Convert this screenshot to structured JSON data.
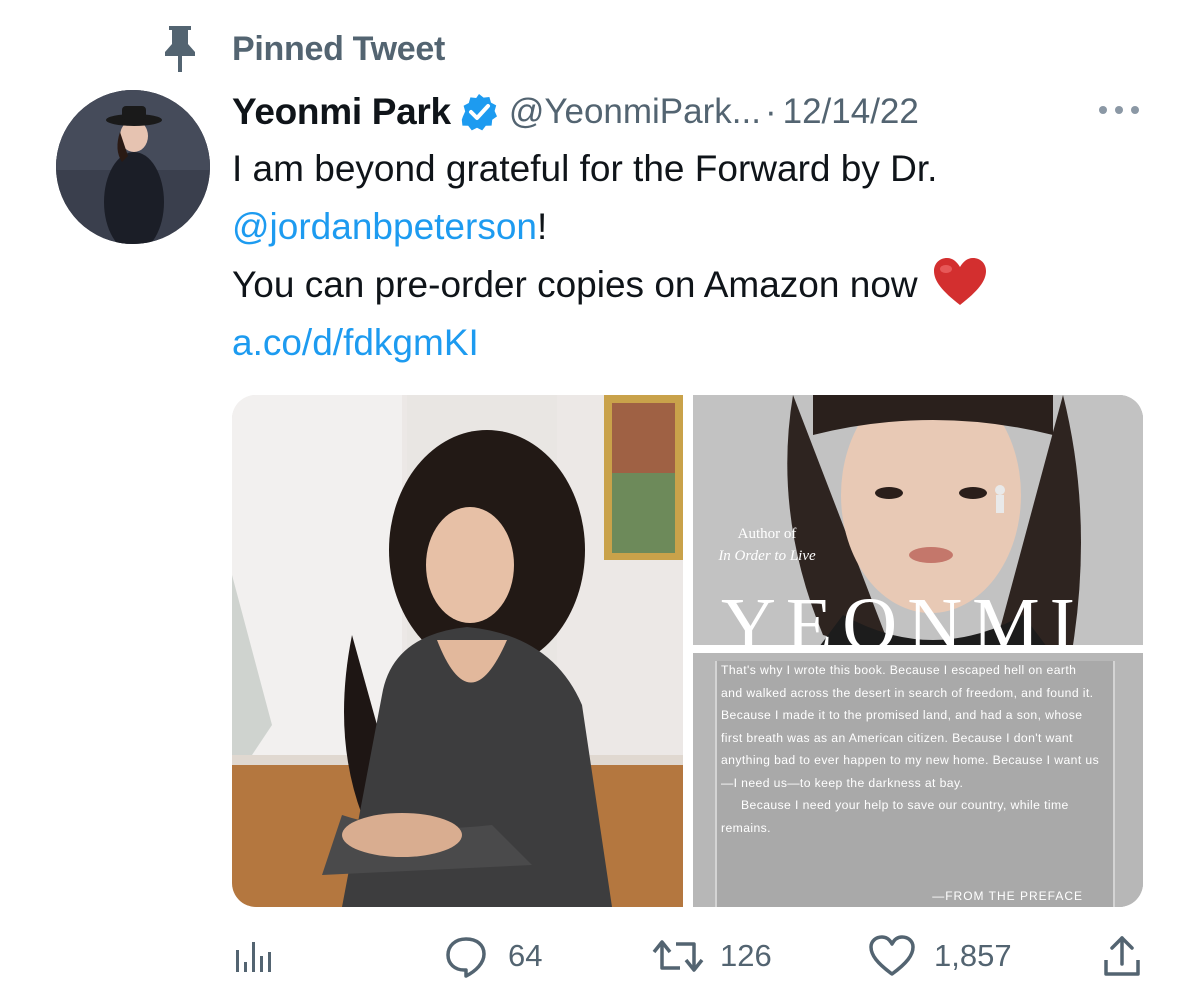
{
  "pinned": {
    "label": "Pinned Tweet",
    "icon": "pin-icon"
  },
  "author": {
    "name": "Yeonmi Park",
    "handle": "@YeonmiPark...",
    "separator": "·",
    "date": "12/14/22",
    "verified": true
  },
  "tweet": {
    "line1": "I am beyond grateful for the Forward by Dr.",
    "mention": "@jordanbpeterson",
    "mention_suffix": "!",
    "line3": "You can pre-order copies on Amazon now",
    "link": "a.co/d/fdkgmKI"
  },
  "book_cover": {
    "author_line1": "Author of",
    "author_line2": "In Order to Live",
    "title": "YEONMI",
    "quote_p1": "That's why I wrote this book. Because I escaped hell on earth and walked across the desert in search of freedom, and found it. Because I made it to the promised land, and had a son, whose first breath was as an American citizen. Because I don't want anything bad to ever happen to my new home. Because I want us—I need us—to keep the darkness at bay.",
    "quote_p2": "Because I need your help to save our country, while time remains.",
    "source": "—FROM THE PREFACE"
  },
  "actions": {
    "replies": "64",
    "retweets": "126",
    "likes": "1,857"
  },
  "colors": {
    "text_primary": "#0f1419",
    "text_secondary": "#536471",
    "link": "#1d9bf0",
    "verified": "#1d9bf0",
    "heart": "#d32f2f"
  }
}
